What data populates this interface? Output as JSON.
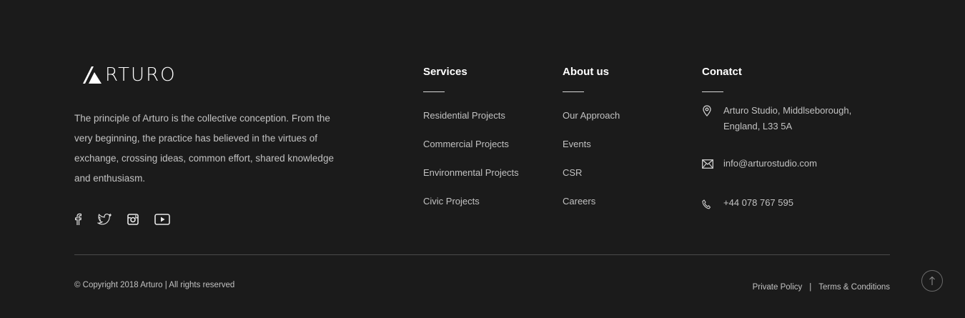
{
  "brand": {
    "name": "RTURO",
    "logo_glyph": "A"
  },
  "about": {
    "text": "The principle of Arturo is the collective conception. From the very beginning, the practice has believed in the virtues of exchange, crossing ideas, common effort, shared knowledge and enthusiasm."
  },
  "social": [
    "facebook-icon",
    "twitter-icon",
    "instagram-icon",
    "youtube-icon"
  ],
  "services": {
    "title": "Services",
    "items": [
      "Residential Projects",
      "Commercial Projects",
      "Environmental Projects",
      "Civic Projects"
    ]
  },
  "about_us": {
    "title": "About us",
    "items": [
      "Our Approach",
      "Events",
      "CSR",
      "Careers"
    ]
  },
  "contact": {
    "title": "Conatct",
    "address_line1": "Arturo Studio, Middlseborough,",
    "address_line2": "England, L33 5A",
    "email": "info@arturostudio.com",
    "phone": "+44 078 767 595"
  },
  "footer": {
    "copyright": "© Copyright 2018 Arturo | All rights reserved",
    "privacy": "Private Policy",
    "separator": "|",
    "terms": "Terms & Conditions"
  },
  "colors": {
    "background": "#1b1b1b",
    "heading": "#ffffff",
    "text": "#c2c2c2"
  }
}
